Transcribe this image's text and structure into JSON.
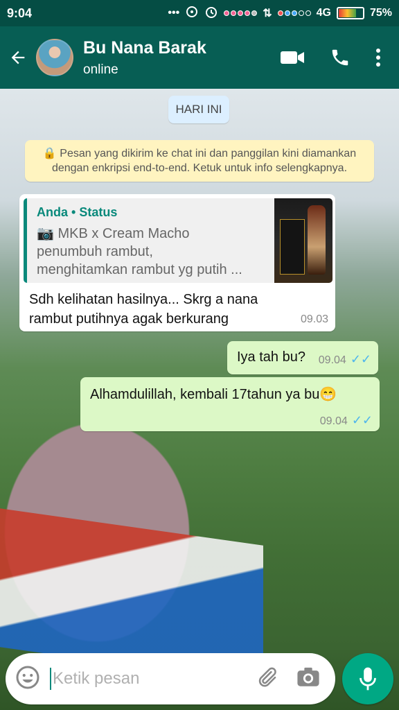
{
  "status_bar": {
    "time": "9:04",
    "network": "4G",
    "battery": "75%",
    "icons": [
      "more-dots-icon",
      "sync-icon",
      "alarm-icon",
      "signal-dots-icon",
      "data-arrows-icon",
      "battery-icon"
    ]
  },
  "header": {
    "contact_name": "Bu Nana Barak",
    "presence": "online",
    "icons": [
      "back-arrow-icon",
      "video-call-icon",
      "phone-icon",
      "overflow-menu-icon"
    ]
  },
  "chat": {
    "date_chip": "HARI INI",
    "encryption_notice_line1": "Pesan yang dikirim ke chat ini dan panggilan kini diamankan",
    "encryption_notice_line2": "dengan enkripsi end-to-end. Ketuk untuk info selengkapnya.",
    "messages": [
      {
        "direction": "incoming",
        "quoted": {
          "author": "Anda",
          "source": "Status",
          "line1": "MKB x Cream Macho",
          "line2": "penumbuh rambut,",
          "line3": "menghitamkan rambut yg putih ..."
        },
        "text_line1": "Sdh kelihatan hasilnya... Skrg a nana",
        "text_line2": "rambut putihnya agak berkurang",
        "time": "09.03"
      },
      {
        "direction": "outgoing",
        "text": "Iya tah bu?",
        "time": "09.04",
        "ticks": "✓✓"
      },
      {
        "direction": "outgoing",
        "text": "Alhamdulillah, kembali 17tahun ya bu",
        "emoji": "😁",
        "time": "09.04",
        "ticks": "✓✓"
      }
    ]
  },
  "composer": {
    "placeholder": "Ketik pesan",
    "icons": [
      "emoji-icon",
      "attach-icon",
      "camera-icon",
      "mic-icon"
    ]
  },
  "colors": {
    "header": "#075e54",
    "status_bar": "#054d44",
    "outgoing_bubble": "#dcf8c6",
    "incoming_bubble": "#ffffff",
    "accent": "#00a884"
  }
}
